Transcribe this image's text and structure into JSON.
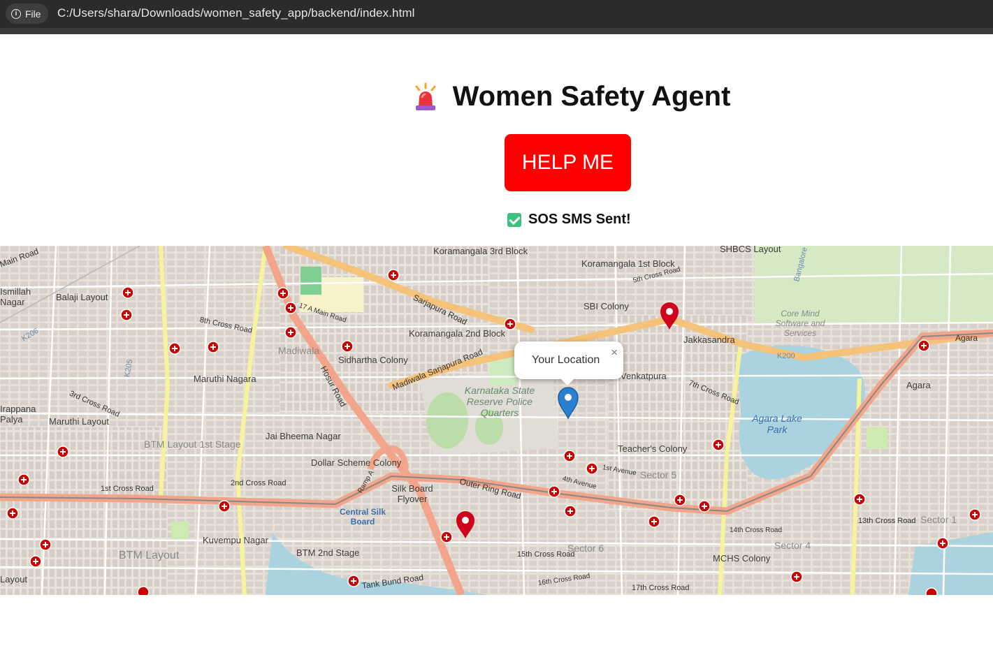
{
  "browser": {
    "file_chip": "File",
    "url": "C:/Users/shara/Downloads/women_safety_app/backend/index.html"
  },
  "header": {
    "title": "Women Safety Agent",
    "icon": "siren-icon"
  },
  "help_button": {
    "label": "HELP ME",
    "color": "#ff0000"
  },
  "status": {
    "text": "SOS SMS Sent!",
    "icon": "check-mark-icon"
  },
  "map": {
    "popup": {
      "text": "Your Location",
      "close": "×"
    },
    "area_labels": [
      "Koramangala 3rd Block",
      "Koramangala 1st Block",
      "Koramangala 2nd Block",
      "SBI Colony",
      "Balaji Layout",
      "Maruthi Nagara",
      "Maruthi Layout",
      "BTM Layout 1st Stage",
      "Jai Bheema Nagar",
      "Dollar Scheme Colony",
      "Madiwala",
      "Sidhartha Colony",
      "Venkatpura",
      "Teacher's Colony",
      "Sector 5",
      "Sector 6",
      "Sector 4",
      "Sector 1",
      "BTM Layout",
      "BTM 2nd Stage",
      "Kuvempu Nagar",
      "MCHS Colony",
      "Jakkasandra",
      "SHBCS Layout",
      "Agara",
      "Core Mind Software and Services",
      "Agara Lake Park",
      "Karnataka State Reserve Police Quarters",
      "Central Silk Board",
      "Silk Board Flyover",
      "Ismillah Nagar",
      "Irappana Palya",
      "Layout"
    ],
    "road_labels": [
      "Sarjapura Road",
      "Madiwala Sarjapura Road",
      "Hosur Road",
      "Outer Ring Road",
      "Main Road",
      "8th Cross Road",
      "1st Cross Road",
      "2nd Cross Road",
      "17 A Main Road",
      "3rd Cross Road",
      "5th Cross Road",
      "7th Cross Road",
      "13th Cross Road",
      "14th Cross Road",
      "15th Cross Road",
      "16th Cross Road",
      "17th Cross Road",
      "Tank Bund Road",
      "4th Avenue",
      "1st Avenue",
      "Ramp A",
      "K206",
      "K205",
      "K200",
      "Bangalore",
      "Sector 1",
      "Agara"
    ],
    "markers": [
      {
        "name": "user-location-pin",
        "color": "#2a7fcf"
      },
      {
        "name": "alert-pin",
        "color": "#d0021b"
      },
      {
        "name": "alert-pin",
        "color": "#d0021b"
      }
    ]
  }
}
